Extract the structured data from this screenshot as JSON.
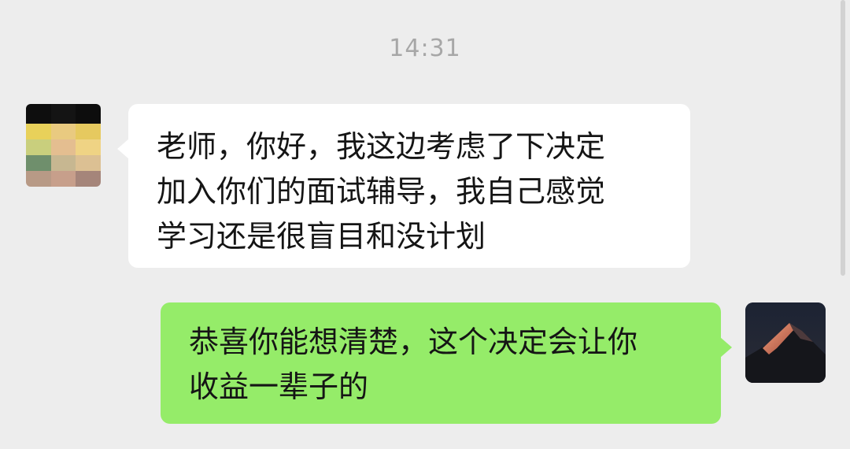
{
  "chat": {
    "timestamp": "14:31",
    "messages": [
      {
        "direction": "incoming",
        "lines": [
          "老师，你好，我这边考虑了下决定",
          "加入你们的面试辅导，我自己感觉",
          "学习还是很盲目和没计划"
        ]
      },
      {
        "direction": "outgoing",
        "lines": [
          "恭喜你能想清楚，这个决定会让你",
          "收益一辈子的"
        ]
      }
    ]
  },
  "colors": {
    "background": "#ededed",
    "incoming_bubble": "#ffffff",
    "outgoing_bubble": "#95ec69",
    "timestamp_text": "#a7a7a7",
    "message_text": "#151515"
  },
  "icons": {
    "incoming_avatar": "pixelated-avatar",
    "outgoing_avatar": "mountain-avatar"
  }
}
